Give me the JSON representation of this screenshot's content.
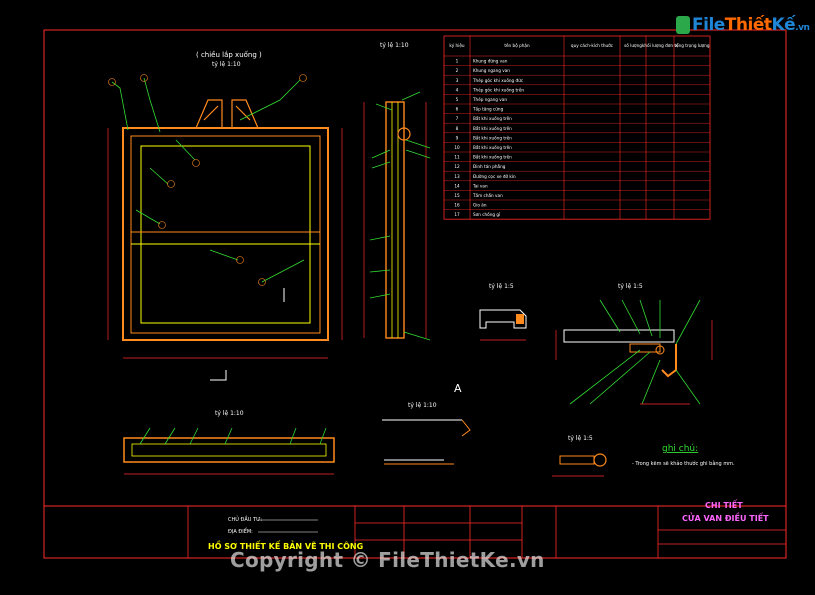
{
  "brand": {
    "file": "File",
    "thiet": "Thiết",
    "ke": "Kế",
    "vn": ".vn"
  },
  "watermark": "Copyright © FileThietKe.vn",
  "views": {
    "front_caption": "( chiều lắp xuống )",
    "front_scale": "tỷ lệ 1:10",
    "side_scale": "tỷ lệ 1:10",
    "detail_a1_scale": "tỷ lệ 1:5",
    "detail_a2_scale": "tỷ lệ 1:5",
    "bottom_scale": "tỷ lệ 1:10",
    "section_scale": "tỷ lệ 1:10",
    "hook_scale": "tỷ lệ 1:5",
    "section_mark": "A"
  },
  "notes": {
    "title": "ghi chú:",
    "line1": "- Trong kẽm sẽ khảo thước ghi bằng mm."
  },
  "table": {
    "headers": [
      "ký hiệu",
      "tên bộ phận",
      "quy cách-kích thước",
      "số lượng",
      "khối lượng đơn vị",
      "tổng trọng lượng"
    ],
    "rows": [
      [
        "1",
        "Khung đứng van",
        "",
        "",
        "",
        ""
      ],
      [
        "2",
        "Khung ngang van",
        "",
        "",
        "",
        ""
      ],
      [
        "3",
        "Thép góc khi xuống đức",
        "",
        "",
        "",
        ""
      ],
      [
        "4",
        "Thép góc khi xuống trên",
        "",
        "",
        "",
        ""
      ],
      [
        "5",
        "Thép ngang van",
        "",
        "",
        "",
        ""
      ],
      [
        "6",
        "Tấp tăng cứng",
        "",
        "",
        "",
        ""
      ],
      [
        "7",
        "Bắt khi xuống trên",
        "",
        "",
        "",
        ""
      ],
      [
        "8",
        "Bắt khi xuống trên",
        "",
        "",
        "",
        ""
      ],
      [
        "9",
        "Bắt khi xuống trên",
        "",
        "",
        "",
        ""
      ],
      [
        "10",
        "Bắt khi xuống trên",
        "",
        "",
        "",
        ""
      ],
      [
        "11",
        "Bắt khi xuống trên",
        "",
        "",
        "",
        ""
      ],
      [
        "12",
        "Đinh tán phẳng",
        "",
        "",
        "",
        ""
      ],
      [
        "13",
        "Đường cọc xe đỡ kín",
        "",
        "",
        "",
        ""
      ],
      [
        "14",
        "Tai van",
        "",
        "",
        "",
        ""
      ],
      [
        "15",
        "Tấm chắn van",
        "",
        "",
        "",
        ""
      ],
      [
        "16",
        "Gio ăn",
        "",
        "",
        "",
        ""
      ],
      [
        "17",
        "Sơn chống gỉ",
        "",
        "",
        "",
        ""
      ]
    ]
  },
  "title_block": {
    "line_a": "CHỦ ĐẦU TƯ:",
    "line_b": "ĐỊA ĐIỂM:",
    "project": "HỒ SƠ THIẾT KẾ BẢN VẼ THI CÔNG",
    "drawing_title_1": "CHI TIẾT",
    "drawing_title_2": "CỬA VAN ĐIỀU TIẾT"
  },
  "colors": {
    "background": "#000000",
    "frame": "#ff2a2a",
    "steel": "#ff8a1e",
    "leader": "#33dd33",
    "dim": "#ff2a2a",
    "text": "#ffffff",
    "tag": "#ffff00",
    "dim_marker": "#00e5ff",
    "title": "#ff66ff"
  }
}
